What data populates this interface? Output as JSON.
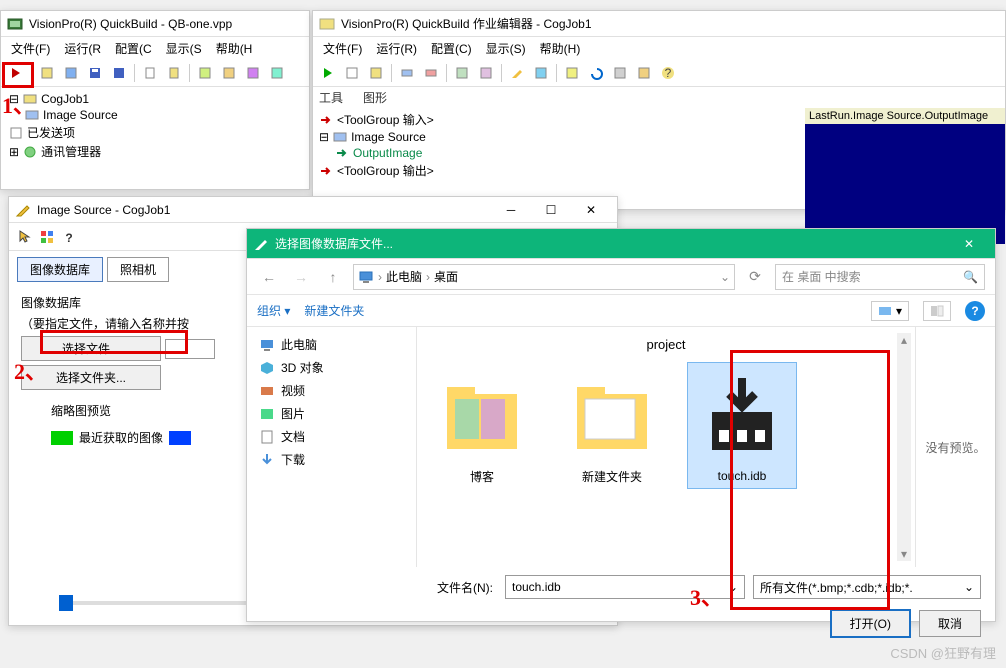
{
  "main": {
    "title": "VisionPro(R) QuickBuild - QB-one.vpp",
    "menu": [
      "文件(F)",
      "运行(R",
      "配置(C",
      "显示(S",
      "帮助(H"
    ],
    "tree": {
      "job": "CogJob1",
      "imgsrc": "Image Source",
      "posted": "已发送项",
      "comm": "通讯管理器"
    }
  },
  "job": {
    "title": "VisionPro(R) QuickBuild 作业编辑器 - CogJob1",
    "menu": [
      "文件(F)",
      "运行(R)",
      "配置(C)",
      "显示(S)",
      "帮助(H)"
    ],
    "sections": {
      "tools": "工具",
      "graphics": "图形"
    },
    "tree": {
      "in": "<ToolGroup 输入>",
      "imgsrc": "Image Source",
      "output": "OutputImage",
      "out": "<ToolGroup 输出>"
    },
    "preview_label": "LastRun.Image Source.OutputImage"
  },
  "imgsrc": {
    "title": "Image Source - CogJob1",
    "tabs": {
      "db": "图像数据库",
      "cam": "照相机"
    },
    "group": "图像数据库",
    "hint": "（要指定文件，请输入名称并按",
    "choose_file": "选择文件...",
    "choose_folder": "选择文件夹...",
    "thumb_label": "缩略图预览",
    "recent_label": "最近获取的图像"
  },
  "file_dialog": {
    "title": "选择图像数据库文件...",
    "breadcrumb": {
      "pc": "此电脑",
      "desktop": "桌面"
    },
    "refresh_icon": "refresh",
    "search_placeholder": "在 桌面 中搜索",
    "organize": "组织",
    "new_folder": "新建文件夹",
    "sidebar": {
      "pc": "此电脑",
      "objects3d": "3D 对象",
      "videos": "视频",
      "pictures": "图片",
      "documents": "文档",
      "downloads": "下载"
    },
    "header": "project",
    "items": {
      "blog": "博客",
      "newfolder": "新建文件夹",
      "touch": "touch.idb"
    },
    "no_preview": "没有预览。",
    "filename_label": "文件名(N):",
    "filename_value": "touch.idb",
    "filter": "所有文件(*.bmp;*.cdb;*.idb;*.",
    "open": "打开(O)",
    "cancel": "取消"
  },
  "annotations": {
    "n1": "1、",
    "n2": "2、",
    "n3": "3、"
  },
  "watermark": "CSDN @狂野有理"
}
